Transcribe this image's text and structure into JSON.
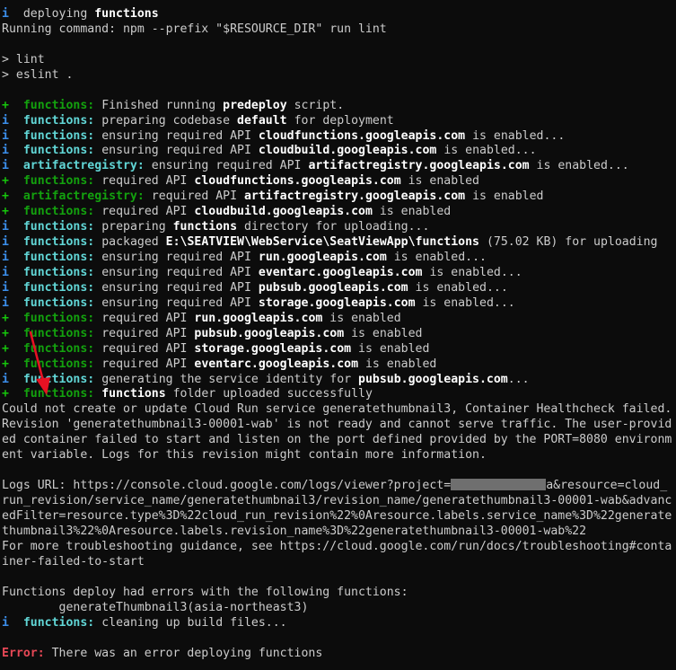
{
  "colors": {
    "background": "#0c0c0c",
    "text": "#cccccc",
    "info_prefix": "#3b8eea",
    "ok_prefix": "#16c60c",
    "label_cyan": "#61d6d6",
    "label_green": "#13a10e",
    "error": "#e74856",
    "arrow": "#e81123"
  },
  "lines": [
    {
      "prefix": "i",
      "segs": [
        {
          "t": "  deploying "
        },
        {
          "t": "functions",
          "b": true
        }
      ]
    },
    {
      "segs": [
        {
          "t": "Running command: npm --prefix \"$RESOURCE_DIR\" run lint"
        }
      ]
    },
    {
      "blank": true
    },
    {
      "segs": [
        {
          "t": "> lint"
        }
      ]
    },
    {
      "segs": [
        {
          "t": "> eslint ."
        }
      ]
    },
    {
      "blank": true
    },
    {
      "prefix": "+",
      "label": "functions:",
      "lc": "green",
      "segs": [
        {
          "t": " Finished running "
        },
        {
          "t": "predeploy",
          "b": true
        },
        {
          "t": " script."
        }
      ]
    },
    {
      "prefix": "i",
      "label": "functions:",
      "lc": "cyan",
      "segs": [
        {
          "t": " preparing codebase "
        },
        {
          "t": "default",
          "b": true
        },
        {
          "t": " for deployment"
        }
      ]
    },
    {
      "prefix": "i",
      "label": "functions:",
      "lc": "cyan",
      "segs": [
        {
          "t": " ensuring required API "
        },
        {
          "t": "cloudfunctions.googleapis.com",
          "b": true
        },
        {
          "t": " is enabled..."
        }
      ]
    },
    {
      "prefix": "i",
      "label": "functions:",
      "lc": "cyan",
      "segs": [
        {
          "t": " ensuring required API "
        },
        {
          "t": "cloudbuild.googleapis.com",
          "b": true
        },
        {
          "t": " is enabled..."
        }
      ]
    },
    {
      "prefix": "i",
      "label": "artifactregistry:",
      "lc": "cyan",
      "segs": [
        {
          "t": " ensuring required API "
        },
        {
          "t": "artifactregistry.googleapis.com",
          "b": true
        },
        {
          "t": " is enabled..."
        }
      ]
    },
    {
      "prefix": "+",
      "label": "functions:",
      "lc": "green",
      "segs": [
        {
          "t": " required API "
        },
        {
          "t": "cloudfunctions.googleapis.com",
          "b": true
        },
        {
          "t": " is enabled"
        }
      ]
    },
    {
      "prefix": "+",
      "label": "artifactregistry:",
      "lc": "green",
      "segs": [
        {
          "t": " required API "
        },
        {
          "t": "artifactregistry.googleapis.com",
          "b": true
        },
        {
          "t": " is enabled"
        }
      ]
    },
    {
      "prefix": "+",
      "label": "functions:",
      "lc": "green",
      "segs": [
        {
          "t": " required API "
        },
        {
          "t": "cloudbuild.googleapis.com",
          "b": true
        },
        {
          "t": " is enabled"
        }
      ]
    },
    {
      "prefix": "i",
      "label": "functions:",
      "lc": "cyan",
      "segs": [
        {
          "t": " preparing "
        },
        {
          "t": "functions",
          "b": true
        },
        {
          "t": " directory for uploading..."
        }
      ]
    },
    {
      "prefix": "i",
      "label": "functions:",
      "lc": "cyan",
      "segs": [
        {
          "t": " packaged "
        },
        {
          "t": "E:\\SEATVIEW\\WebService\\SeatViewApp\\functions",
          "b": true
        },
        {
          "t": " (75.02 KB) for uploading"
        }
      ]
    },
    {
      "prefix": "i",
      "label": "functions:",
      "lc": "cyan",
      "segs": [
        {
          "t": " ensuring required API "
        },
        {
          "t": "run.googleapis.com",
          "b": true
        },
        {
          "t": " is enabled..."
        }
      ]
    },
    {
      "prefix": "i",
      "label": "functions:",
      "lc": "cyan",
      "segs": [
        {
          "t": " ensuring required API "
        },
        {
          "t": "eventarc.googleapis.com",
          "b": true
        },
        {
          "t": " is enabled..."
        }
      ]
    },
    {
      "prefix": "i",
      "label": "functions:",
      "lc": "cyan",
      "segs": [
        {
          "t": " ensuring required API "
        },
        {
          "t": "pubsub.googleapis.com",
          "b": true
        },
        {
          "t": " is enabled..."
        }
      ]
    },
    {
      "prefix": "i",
      "label": "functions:",
      "lc": "cyan",
      "segs": [
        {
          "t": " ensuring required API "
        },
        {
          "t": "storage.googleapis.com",
          "b": true
        },
        {
          "t": " is enabled..."
        }
      ]
    },
    {
      "prefix": "+",
      "label": "functions:",
      "lc": "green",
      "segs": [
        {
          "t": " required API "
        },
        {
          "t": "run.googleapis.com",
          "b": true
        },
        {
          "t": " is enabled"
        }
      ]
    },
    {
      "prefix": "+",
      "label": "functions:",
      "lc": "green",
      "segs": [
        {
          "t": " required API "
        },
        {
          "t": "pubsub.googleapis.com",
          "b": true
        },
        {
          "t": " is enabled"
        }
      ]
    },
    {
      "prefix": "+",
      "label": "functions:",
      "lc": "green",
      "segs": [
        {
          "t": " required API "
        },
        {
          "t": "storage.googleapis.com",
          "b": true
        },
        {
          "t": " is enabled"
        }
      ]
    },
    {
      "prefix": "+",
      "label": "functions:",
      "lc": "green",
      "segs": [
        {
          "t": " required API "
        },
        {
          "t": "eventarc.googleapis.com",
          "b": true
        },
        {
          "t": " is enabled"
        }
      ]
    },
    {
      "prefix": "i",
      "label": "functions:",
      "lc": "cyan",
      "segs": [
        {
          "t": " generating the service identity for "
        },
        {
          "t": "pubsub.googleapis.com",
          "b": true
        },
        {
          "t": "..."
        }
      ]
    },
    {
      "prefix": "+",
      "label": "functions:",
      "lc": "green",
      "segs": [
        {
          "t": " "
        },
        {
          "t": "functions",
          "b": true
        },
        {
          "t": " folder uploaded successfully"
        }
      ]
    },
    {
      "wrap": true,
      "segs": [
        {
          "t": "Could not create or update Cloud Run service generatethumbnail3, Container Healthcheck failed. Revision 'generatethumbnail3-00001-wab' is not ready and cannot serve traffic. The user-provided container failed to start and listen on the port defined provided by the PORT=8080 environment variable. Logs for this revision might contain more information."
        }
      ]
    },
    {
      "blank": true
    },
    {
      "wrap": true,
      "segs": [
        {
          "t": "Logs URL: https://console.cloud.google.com/logs/viewer?project="
        },
        {
          "redact": true
        },
        {
          "t": "a&resource=cloud_run_revision/service_name/generatethumbnail3/revision_name/generatethumbnail3-00001-wab&advancedFilter=resource.type%3D%22cloud_run_revision%22%0Aresource.labels.service_name%3D%22generatethumbnail3%22%0Aresource.labels.revision_name%3D%22generatethumbnail3-00001-wab%22"
        }
      ]
    },
    {
      "wrap": true,
      "segs": [
        {
          "t": "For more troubleshooting guidance, see https://cloud.google.com/run/docs/troubleshooting#container-failed-to-start"
        }
      ]
    },
    {
      "blank": true
    },
    {
      "segs": [
        {
          "t": "Functions deploy had errors with the following functions:"
        }
      ]
    },
    {
      "segs": [
        {
          "t": "        generateThumbnail3(asia-northeast3)"
        }
      ]
    },
    {
      "prefix": "i",
      "label": "functions:",
      "lc": "cyan",
      "segs": [
        {
          "t": " cleaning up build files..."
        }
      ]
    },
    {
      "blank": true
    },
    {
      "label": "Error:",
      "lc": "red",
      "segs": [
        {
          "t": " There was an error deploying functions"
        }
      ]
    }
  ]
}
